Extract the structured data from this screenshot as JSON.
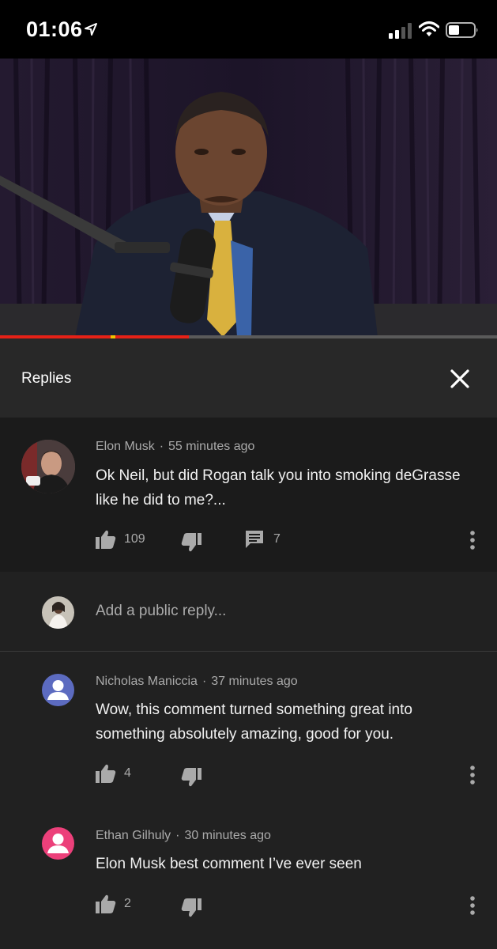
{
  "status_bar": {
    "time": "01:06",
    "icons": [
      "location-arrow-icon",
      "signal-icon",
      "wifi-icon",
      "battery-icon"
    ]
  },
  "video": {
    "progress_percent": 38,
    "colors": {
      "played": "#e62117",
      "track": "#5a5a5a",
      "ad_marker": "#f2c200"
    }
  },
  "replies_panel": {
    "title": "Replies",
    "close_icon": "close-icon"
  },
  "parent_comment": {
    "author": "Elon Musk",
    "time": "55 minutes ago",
    "text_line1": "Ok Neil, but did Rogan talk you into smoking deGrasse",
    "text_line2": "like he did to me?...",
    "likes": "109",
    "replies_count": "7"
  },
  "add_reply": {
    "placeholder": "Add a public reply..."
  },
  "replies": [
    {
      "author": "Nicholas Maniccia",
      "time": "37 minutes ago",
      "text_line1": "Wow, this comment turned something great into",
      "text_line2": "something absolutely amazing, good for you.",
      "likes": "4",
      "avatar_color": "#5c6bc0"
    },
    {
      "author": "Ethan Gilhuly",
      "time": "30 minutes ago",
      "text_line1": "Elon Musk best comment I’ve ever seen",
      "likes": "2",
      "avatar_color": "#ec407a"
    }
  ]
}
